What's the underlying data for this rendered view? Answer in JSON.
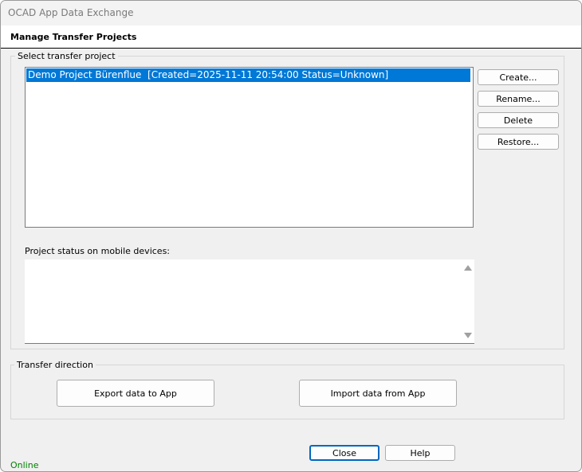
{
  "window": {
    "title": "OCAD App Data Exchange"
  },
  "header": {
    "title": "Manage Transfer Projects"
  },
  "select_group": {
    "label": "Select transfer project",
    "projects": [
      "Demo Project Bürenflue  [Created=2025-11-11 20:54:00 Status=Unknown]"
    ],
    "selected_index": 0,
    "buttons": {
      "create": "Create...",
      "rename": "Rename...",
      "delete": "Delete",
      "restore": "Restore..."
    },
    "status_label": "Project status on mobile devices:",
    "status_text": ""
  },
  "transfer_group": {
    "label": "Transfer direction",
    "export_label": "Export data to App",
    "import_label": "Import data from App"
  },
  "footer": {
    "close_label": "Close",
    "help_label": "Help",
    "status": "Online",
    "status_color": "#008000"
  },
  "colors": {
    "selection": "#0078d7",
    "dialog_bg": "#f0f0f0"
  }
}
